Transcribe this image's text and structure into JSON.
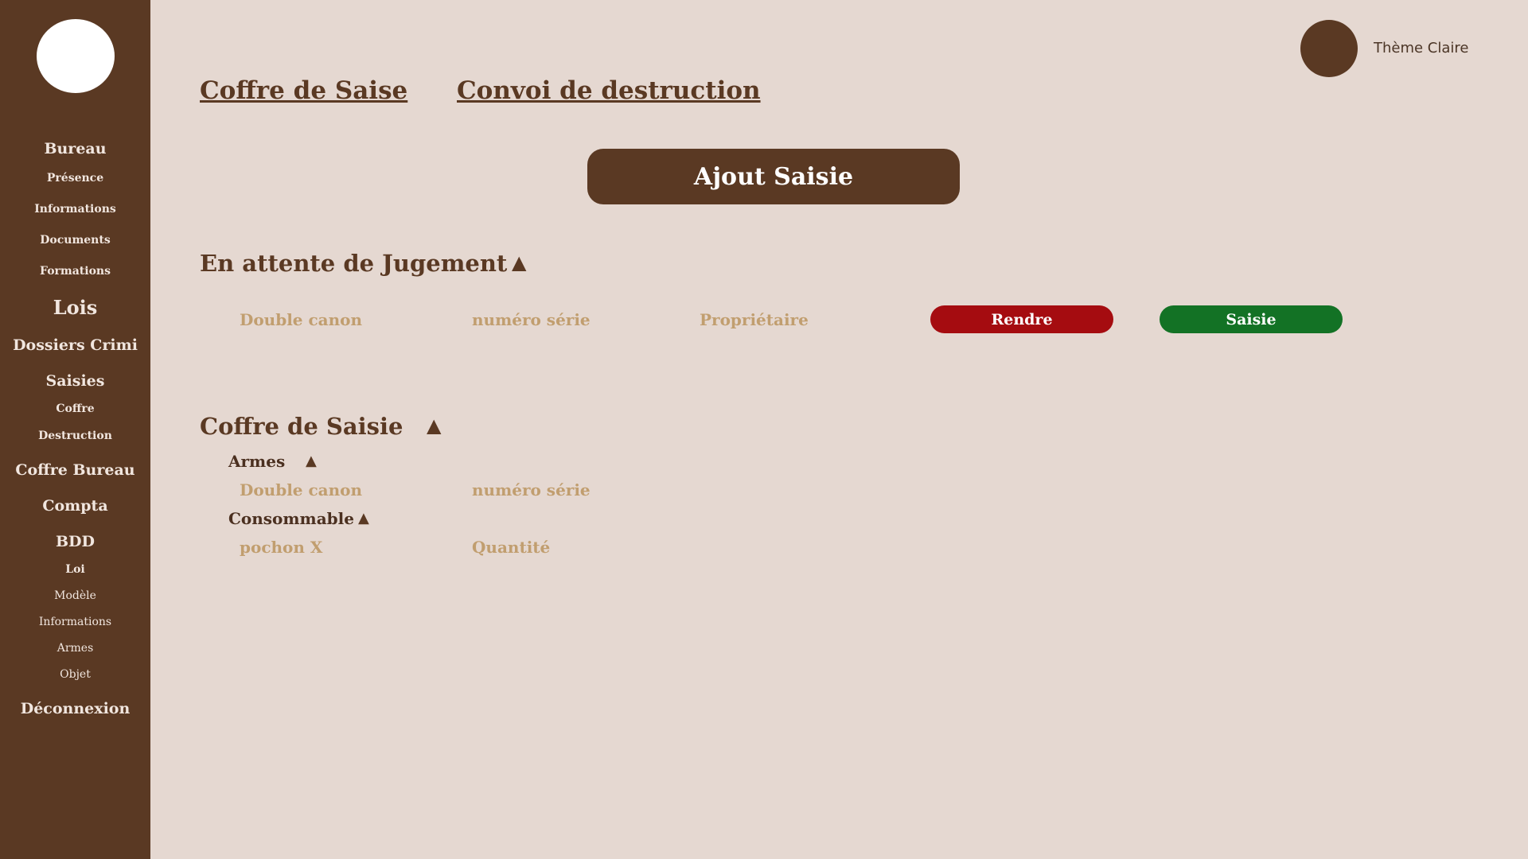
{
  "sidebar": {
    "items": [
      {
        "label": "Bureau"
      },
      {
        "label": "Présence"
      },
      {
        "label": "Informations"
      },
      {
        "label": "Documents"
      },
      {
        "label": "Formations"
      },
      {
        "label": "Lois"
      },
      {
        "label": "Dossiers Crimi"
      },
      {
        "label": "Saisies"
      },
      {
        "label": "Coffre"
      },
      {
        "label": "Destruction"
      },
      {
        "label": "Coffre Bureau"
      },
      {
        "label": "Compta"
      },
      {
        "label": "BDD"
      },
      {
        "label": "Loi"
      },
      {
        "label": "Modèle"
      },
      {
        "label": "Informations"
      },
      {
        "label": "Armes"
      },
      {
        "label": "Objet"
      },
      {
        "label": "Déconnexion"
      }
    ]
  },
  "header": {
    "theme_label": "Thème Claire",
    "tabs": [
      {
        "label": "Coffre de Saise"
      },
      {
        "label": "Convoi de destruction"
      }
    ]
  },
  "main": {
    "add_button": "Ajout Saisie",
    "pending": {
      "title": "En attente de Jugement",
      "toggle": "▲",
      "row": {
        "item": "Double canon",
        "serial": "numéro série",
        "owner": "Propriétaire",
        "return_button": "Rendre",
        "seize_button": "Saisie"
      }
    },
    "vault": {
      "title": "Coffre de Saisie",
      "toggle": "▲",
      "weapons": {
        "title": "Armes",
        "toggle": "▲",
        "row": {
          "item": "Double canon",
          "serial": "numéro série"
        }
      },
      "consumables": {
        "title": "Consommable",
        "toggle": "▲",
        "row": {
          "item": "pochon X",
          "quantity": "Quantité"
        }
      }
    }
  },
  "colors": {
    "sidebar": "#5a3923",
    "background": "#e5d8d1",
    "accent": "#5a3923",
    "muted_text": "#c19e6f",
    "danger": "#a50c10",
    "success": "#137225"
  }
}
